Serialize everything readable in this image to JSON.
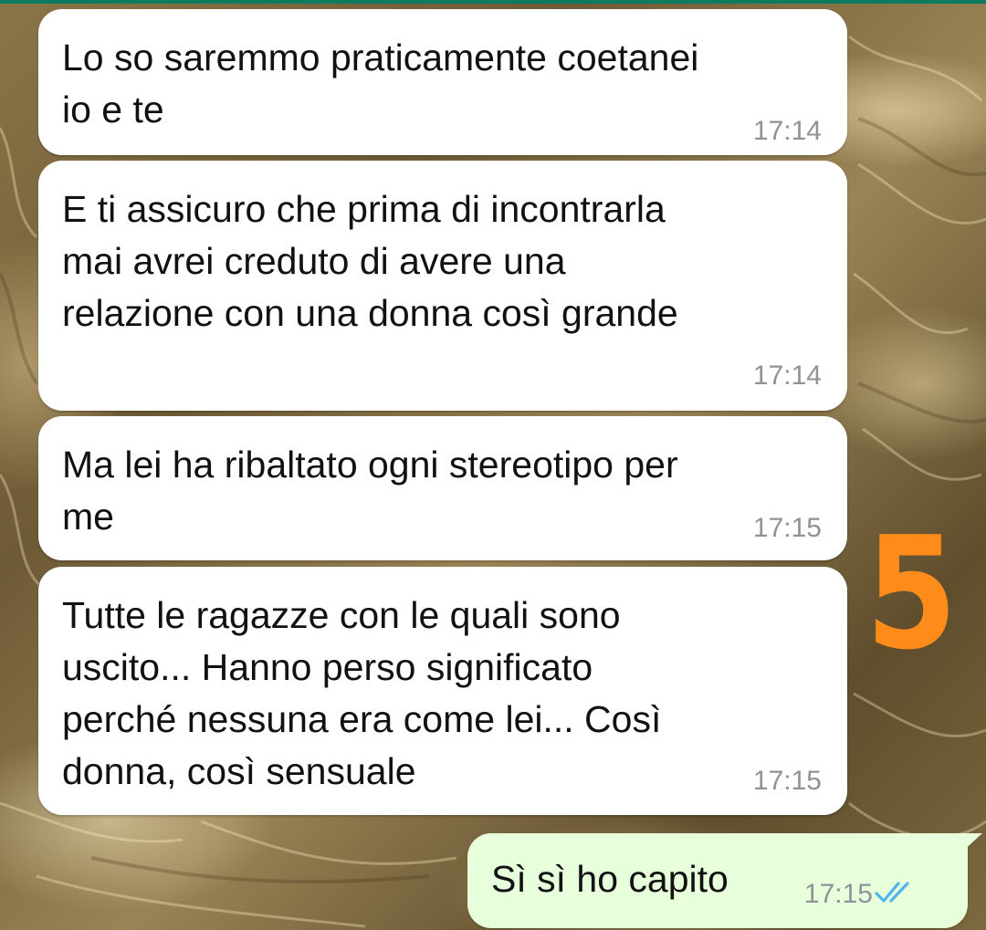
{
  "messages": [
    {
      "text": "Lo so saremmo praticamente coetanei\nio e te",
      "time": "17:14",
      "direction": "incoming"
    },
    {
      "text": "E ti assicuro che prima di incontrarla\nmai avrei creduto di avere una\nrelazione con una donna così grande",
      "time": "17:14",
      "direction": "incoming"
    },
    {
      "text": "Ma lei ha ribaltato ogni stereotipo per\nme",
      "time": "17:15",
      "direction": "incoming"
    },
    {
      "text": "Tutte le ragazze con le quali sono\nuscito... Hanno perso significato\nperché nessuna era come lei... Così\ndonna, così sensuale",
      "time": "17:15",
      "direction": "incoming"
    },
    {
      "text": "Sì sì ho capito",
      "time": "17:15",
      "direction": "outgoing",
      "status": "read"
    }
  ],
  "annotation": {
    "text": "5",
    "color": "#ff8c1a"
  },
  "colors": {
    "incoming_bubble": "#ffffff",
    "outgoing_bubble": "#e7ffdb",
    "timestamp": "#8d9399",
    "read_ticks": "#4fb6ec"
  },
  "icons": {
    "read_status": "double-check-icon"
  }
}
